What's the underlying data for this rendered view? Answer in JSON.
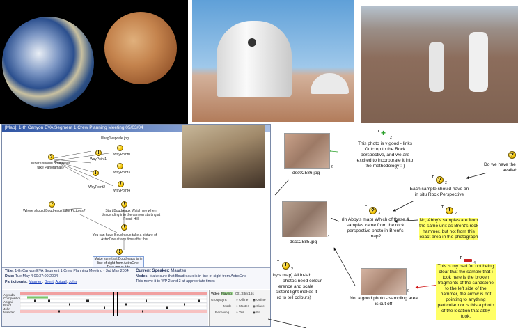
{
  "window": {
    "title": "[Map]: 1-th Canyon EVA Segment 1 Crew Planning Meeting 05/03/04"
  },
  "map_nodes": {
    "file_label": "lilbag1vepcale.jpg",
    "q1": "Where should Boudreaux take Panoramas?",
    "wp0": "WayPoint0",
    "wp1": "WayPoint1",
    "wp2": "WayPoint2",
    "wp3": "WayPoint3",
    "wp4": "WayPoint4",
    "q2": "Where should Boudreaux take Pictures?",
    "n_start": "Start Boudreaux Watch me when descending into the canyon starting at Fossil Hill",
    "n_astro": "You can have Boudreaux take a picture of AstroOne at any time after that",
    "n_sight": "Make sure that Boudreaux is in line of sight from AstroOne. Thus move it to"
  },
  "meeting": {
    "title_label": "Title:",
    "title_value": "1-th Canyon EVA Segment 1 Crew Planning Meeting - 3rd May 2004",
    "date_label": "Date:",
    "date_value": "Tue May 4 00:37:00 2004",
    "participants_label": "Participants:",
    "participants": [
      "Maarten",
      "Brent",
      "Abigail",
      "John"
    ],
    "speaker_label": "Current Speaker:",
    "speaker_value": "Maarten",
    "nodes_label": "Nodes:",
    "nodes_value": "Make sure that Boudreaux is in line of sight from AstroOne",
    "nodes_value2": "This move it to WP 2 and 3 at appropriate times"
  },
  "timeline": {
    "rows": [
      "Agenda",
      "Composition",
      "Abigail",
      "Brent",
      "John",
      "Maarten"
    ]
  },
  "controls": {
    "video_label": "Video",
    "video_state": "Playing",
    "time": "001:33m:16s",
    "groupsync_label": "GroupSync",
    "offline": "Offline",
    "online": "Online",
    "mode_label": "Mode",
    "master": "Master",
    "slave": "Slave",
    "receiving_label": "Receiving",
    "yes": "Yes",
    "no": "No"
  },
  "right_map": {
    "c1": "This photo is v good - links Outcrop to the Rock perspective, and we are excited to incorporate it into the methodology :-)",
    "c2": "Do we have the",
    "c2b": "availab",
    "c3": "Each sample should have an in situ Rock Perspective",
    "c4": "(In Abby's map) Which of these 4 samples came from the rock perspective photo in Brent's map?",
    "c5": "No, Abby's samples are from the same unit as Brent's rock hammer, but not from this exact area in the photograph",
    "c6": "This is my bad for not being clear that the sample that i took here is the broken fragments of the sandstone to the left side of the hammer, the arrow is not pointing to anything particular nor is this a photo of the location that abby took.",
    "c7": "Not a good photo - sampling area is cut off",
    "c8_1": "by's map) All in-lab",
    "c8_2": "photos need colour",
    "c8_3": "erence and scale",
    "c8_4": "sistent light makes it",
    "c8_5": "rd to tell colours)",
    "img1": "dsc02586.jpg",
    "img2": "dsc02585.jpg",
    "n2": "2",
    "n3": "3",
    "n4": "4",
    "t": "T"
  }
}
